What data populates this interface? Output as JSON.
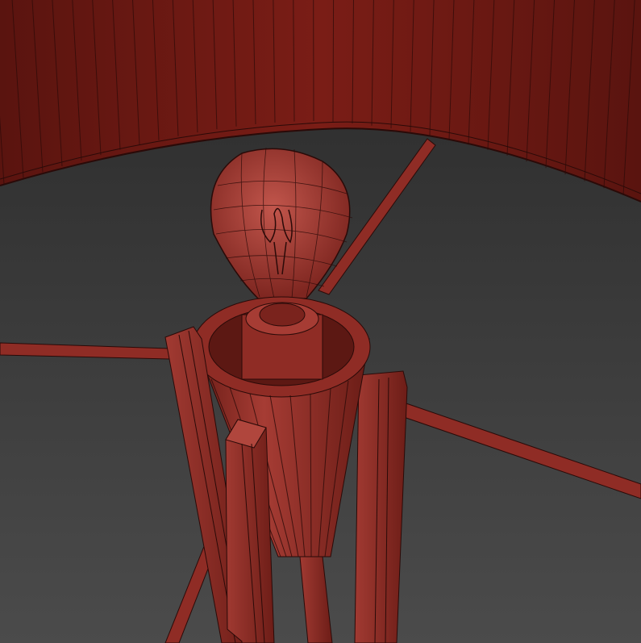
{
  "viewport": {
    "background_top": "#2b2b2b",
    "background_bottom": "#4a4a4a"
  },
  "colors": {
    "mesh_fill": "#8a2a24",
    "mesh_dark": "#5c1813",
    "mesh_light": "#a8413a",
    "wire": "#2a0a08",
    "shade_edge": "#6e1d17"
  }
}
